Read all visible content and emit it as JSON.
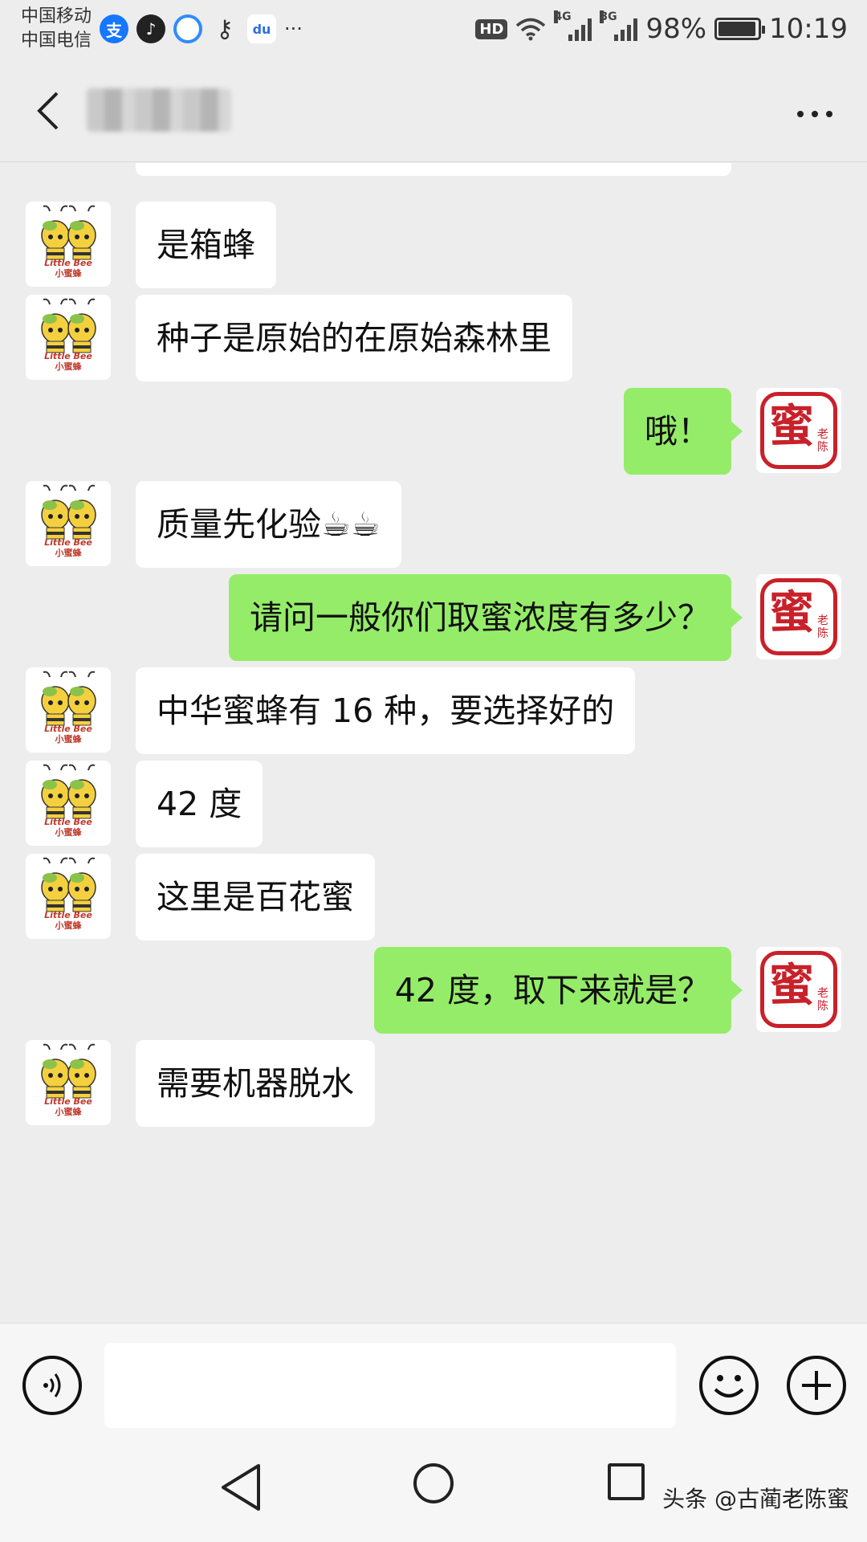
{
  "status_bar": {
    "carrier_1": "中国移动",
    "carrier_2": "中国电信",
    "app_icons": [
      "alipay-icon",
      "tiktok-icon",
      "qq-browser-icon",
      "key-icon",
      "baidu-icon"
    ],
    "more_icons": "···",
    "hd": "HD",
    "network_1": "4G",
    "network_2": "3G",
    "battery": "98%",
    "time": "10:19"
  },
  "chat": {
    "title": "",
    "more_label": "···"
  },
  "messages": [
    {
      "side": "left",
      "text": "是箱蜂"
    },
    {
      "side": "left",
      "text": "种子是原始的在原始森林里"
    },
    {
      "side": "right",
      "text": "哦！"
    },
    {
      "side": "left",
      "text": "质量先化验☕☕"
    },
    {
      "side": "right",
      "text": "请问一般你们取蜜浓度有多少？"
    },
    {
      "side": "left",
      "text": "中华蜜蜂有 16 种，要选择好的"
    },
    {
      "side": "left",
      "text": "42 度"
    },
    {
      "side": "left",
      "text": "这里是百花蜜"
    },
    {
      "side": "right",
      "text": "42 度，取下来就是？"
    },
    {
      "side": "left",
      "text": "需要机器脱水"
    }
  ],
  "avatars": {
    "left_caption_en": "Little Bee",
    "left_caption_cn": "小蜜蜂",
    "right_seal_main": "蜜",
    "right_seal_side": "老陈"
  },
  "input": {
    "value": "",
    "placeholder": ""
  },
  "watermark": "头条 @古蔺老陈蜜",
  "colors": {
    "background": "#ededed",
    "sent_bubble": "#95ec69",
    "received_bubble": "#ffffff",
    "seal_red": "#c8212a"
  }
}
